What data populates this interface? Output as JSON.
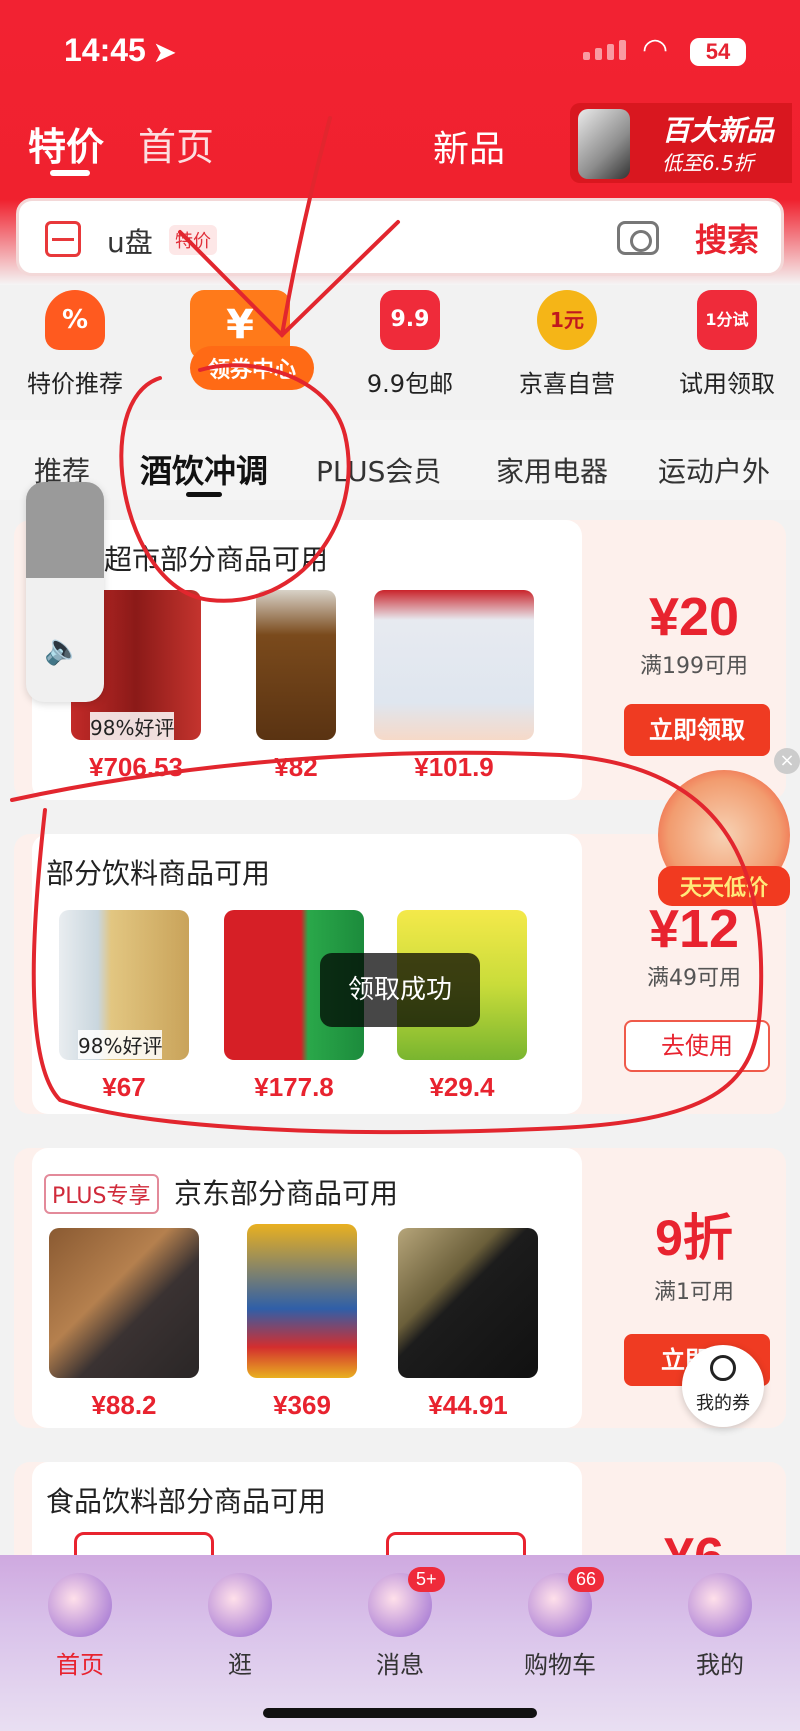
{
  "status_bar": {
    "time": "14:45",
    "battery": "54"
  },
  "top_tabs": {
    "special": "特价",
    "home": "首页",
    "new": "新品"
  },
  "promo": {
    "title": "百大新品",
    "subtitle": "低至6.5折"
  },
  "search": {
    "keyword": "u盘",
    "tag": "特价",
    "button": "搜索"
  },
  "categories": [
    {
      "icon": "%",
      "label": "特价推荐",
      "color": "#ff5a1f"
    },
    {
      "icon": "¥",
      "label": "领券中心",
      "color": "#ff7a1a"
    },
    {
      "icon": "9.9",
      "label": "9.9包邮",
      "color": "#ef2b3a"
    },
    {
      "icon": "1元",
      "label": "京喜自营",
      "color": "#f5b517"
    },
    {
      "icon": "1分试",
      "label": "试用领取",
      "color": "#ef2b3a"
    }
  ],
  "subtabs": [
    "推荐",
    "酒饮冲调",
    "PLUS会员",
    "家用电器",
    "运动户外"
  ],
  "cards": [
    {
      "title": "超市部分商品可用",
      "amount": "¥20",
      "condition": "满199可用",
      "button": "立即领取",
      "products": [
        {
          "price": "¥706.53",
          "rating": "98%好评"
        },
        {
          "price": "¥82"
        },
        {
          "price": "¥101.9"
        }
      ]
    },
    {
      "title": "部分饮料商品可用",
      "amount": "¥12",
      "condition": "满49可用",
      "button": "去使用",
      "products": [
        {
          "price": "¥67",
          "rating": "98%好评"
        },
        {
          "price": "¥177.8"
        },
        {
          "price": "¥29.4"
        }
      ]
    },
    {
      "tag": "PLUS专享",
      "title": "京东部分商品可用",
      "amount": "9折",
      "condition": "满1可用",
      "button": "立即领",
      "products": [
        {
          "price": "¥88.2"
        },
        {
          "price": "¥369"
        },
        {
          "price": "¥44.91"
        }
      ]
    },
    {
      "title": "食品饮料部分商品可用",
      "amount": "¥6"
    }
  ],
  "toast": "领取成功",
  "floating_ad": "天天低价",
  "my_coupon": "我的券",
  "bottom_nav": [
    {
      "label": "首页"
    },
    {
      "label": "逛"
    },
    {
      "label": "消息",
      "badge": "5+"
    },
    {
      "label": "购物车",
      "badge": "66"
    },
    {
      "label": "我的"
    }
  ]
}
